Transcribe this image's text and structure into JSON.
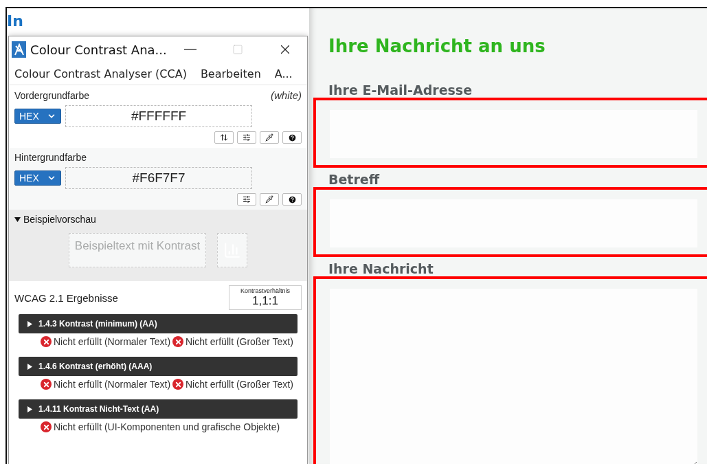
{
  "page_heading": "In",
  "cca_window": {
    "title": "Colour Contrast Ana...",
    "menu": [
      "Colour Contrast Analyser (CCA)",
      "Bearbeiten",
      "A..."
    ],
    "foreground": {
      "label": "Vordergrundfarbe",
      "name": "(white)",
      "format": "HEX",
      "value": "#FFFFFF",
      "tools": [
        {
          "kind": "swap"
        },
        {
          "kind": "sliders"
        },
        {
          "kind": "picker"
        },
        {
          "kind": "help"
        }
      ]
    },
    "background": {
      "label": "Hintergrundfarbe",
      "format": "HEX",
      "value": "#F6F7F7",
      "tools": [
        {
          "kind": "sliders"
        },
        {
          "kind": "picker"
        },
        {
          "kind": "help"
        }
      ]
    },
    "preview": {
      "title": "Beispielvorschau",
      "expanded": true,
      "sample_text": "Beispieltext mit Kontrast"
    },
    "results": {
      "title": "WCAG 2.1 Ergebnisse",
      "ratio_label": "Kontrastverhältnis",
      "ratio": "1,1:1",
      "criteria": [
        {
          "title": "1.4.3 Kontrast (minimum) (AA)",
          "expanded": false,
          "checks": [
            {
              "text": "Nicht erfüllt (Normaler Text)",
              "passed": false
            },
            {
              "text": "Nicht erfüllt (Großer Text)",
              "passed": false
            }
          ]
        },
        {
          "title": "1.4.6 Kontrast (erhöht) (AAA)",
          "expanded": false,
          "checks": [
            {
              "text": "Nicht erfüllt (Normaler Text)",
              "passed": false
            },
            {
              "text": "Nicht erfüllt (Großer Text)",
              "passed": false
            }
          ]
        },
        {
          "title": "1.4.11 Kontrast Nicht-Text (AA)",
          "expanded": false,
          "checks": [
            {
              "text": "Nicht erfüllt (UI-Komponenten und grafische Objekte)",
              "passed": false
            }
          ]
        }
      ]
    }
  },
  "form": {
    "title": "Ihre Nachricht an uns",
    "fields": [
      {
        "label": "Ihre E-Mail-Adresse",
        "kind": "input",
        "highlighted": true
      },
      {
        "label": "Betreff",
        "kind": "input",
        "highlighted": true
      },
      {
        "label": "Ihre Nachricht",
        "kind": "textarea",
        "highlighted": true
      }
    ]
  }
}
